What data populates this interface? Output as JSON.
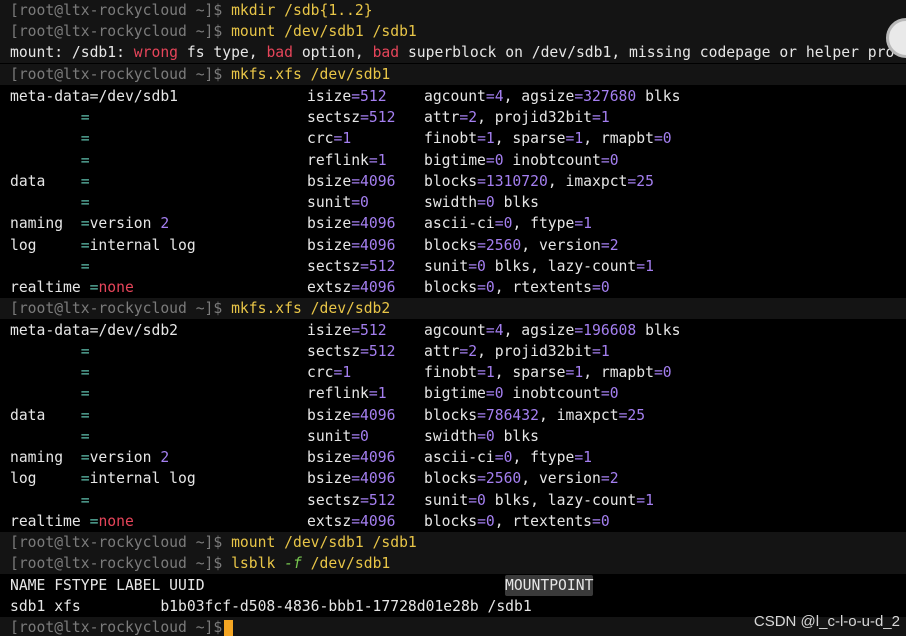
{
  "prompt": "[root@ltx-rockycloud ~]$",
  "commands": {
    "c1": "mkdir /sdb{1..2}",
    "c2": "mount /dev/sdb1 /sdb1",
    "c3": "mkfs.xfs /dev/sdb1",
    "c4": "mkfs.xfs /dev/sdb2",
    "c5": "mount /dev/sdb1 /sdb1",
    "c6a": "lsblk ",
    "c6b": "-f",
    "c6c": " /dev/sdb1"
  },
  "error": {
    "p1": "mount: /sdb1: ",
    "p2": "wrong",
    "p3": " fs type, ",
    "p4": "bad",
    "p5": " option, ",
    "p6": "bad",
    "p7": " superblock on /dev/sdb1, missing codepage or helper pro"
  },
  "mkfs1": {
    "r1": {
      "a1": "meta-data=",
      "a2": "/dev/sdb1",
      "b1": "isize",
      "b2": "=512",
      "c1": "agcount",
      "c2": "=4",
      ", agsize": "",
      "c3": ", agsize",
      "c4": "=327680",
      "c5": " blks"
    },
    "r2": {
      "b1": "sectsz",
      "b2": "=512",
      "c1": "attr",
      "c2": "=2",
      ", projid32bit": "",
      "c3": ", projid32bit",
      "c4": "=1"
    },
    "r3": {
      "b1": "crc",
      "b2": "=1",
      "c1": "finobt",
      "c2": "=1",
      "c3": ", sparse",
      "c4": "=1",
      "c5": ", rmapbt",
      "c6": "=0"
    },
    "r4": {
      "b1": "reflink",
      "b2": "=1",
      "c1": "bigtime",
      "c2": "=0",
      "c3": " inobtcount",
      "c4": "=0"
    },
    "r5": {
      "a1": "data",
      "b1": "bsize",
      "b2": "=4096",
      "c1": "blocks",
      "c2": "=1310720",
      "c3": ", imaxpct",
      "c4": "=25"
    },
    "r6": {
      "b1": "sunit",
      "b2": "=0",
      "c1": "swidth",
      "c2": "=0",
      "c3": " blks"
    },
    "r7": {
      "a1": "naming",
      "a2": "version",
      "a3": " 2",
      "b1": "bsize",
      "b2": "=4096",
      "c1": "ascii-ci",
      "c2": "=0",
      "c3": ", ftype",
      "c4": "=1"
    },
    "r8": {
      "a1": "log",
      "a2": "internal log",
      "b1": "bsize",
      "b2": "=4096",
      "c1": "blocks",
      "c2": "=2560",
      "c3": ", version",
      "c4": "=2"
    },
    "r9": {
      "b1": "sectsz",
      "b2": "=512",
      "c1": "sunit",
      "c2": "=0",
      "c3": " blks, lazy-count",
      "c4": "=1"
    },
    "r10": {
      "a1": "realtime",
      "a2": "none",
      "b1": "extsz",
      "b2": "=4096",
      "c1": "blocks",
      "c2": "=0",
      "c3": ", rtextents",
      "c4": "=0"
    }
  },
  "mkfs2": {
    "r1": {
      "a2": "/dev/sdb2",
      "c4": "=196608"
    },
    "r5": {
      "c2": "=786432"
    }
  },
  "lsblk": {
    "h1": "NAME FSTYPE LABEL UUID",
    "h2": "MOUNTPOINT",
    "row": "sdb1 xfs         b1b03fcf-d508-4836-bbb1-17728d01e28b /sdb1"
  },
  "watermark": "CSDN @l_c-l-o-u-d_2",
  "colors": {
    "prompt": "#7b7b7b",
    "command": "#e8c547",
    "error": "#e6455a",
    "value": "#a47ff0",
    "equals": "#5fbfae",
    "cursor": "#f5a623"
  }
}
